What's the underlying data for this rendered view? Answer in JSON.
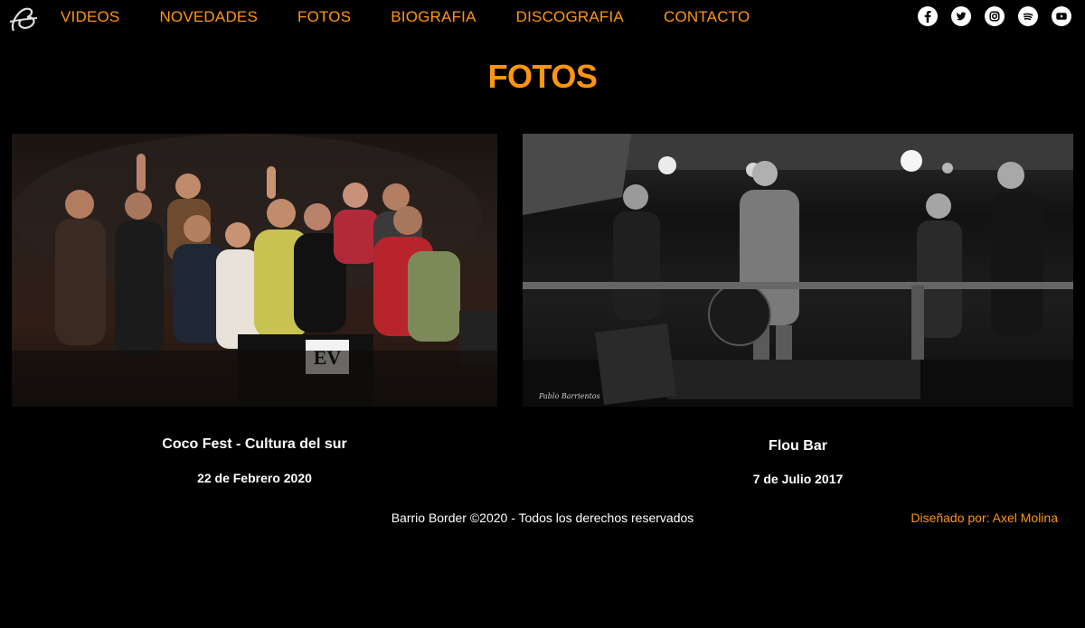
{
  "nav": {
    "items": [
      "VIDEOS",
      "NOVEDADES",
      "FOTOS",
      "BIOGRAFIA",
      "DISCOGRAFIA",
      "CONTACTO"
    ]
  },
  "social": [
    "facebook-icon",
    "twitter-icon",
    "instagram-icon",
    "spotify-icon",
    "youtube-icon"
  ],
  "page": {
    "title": "FOTOS"
  },
  "photos": [
    {
      "title": "Coco Fest - Cultura del sur",
      "date": "22 de Febrero 2020",
      "sign": "EV"
    },
    {
      "title": "Flou Bar",
      "date": "7 de Julio 2017",
      "watermark": "Pablo Barrientos"
    }
  ],
  "footer": {
    "copyright": "Barrio Border ©2020 - Todos los derechos reservados",
    "designed_by": "Diseñado por: Axel Molina"
  },
  "colors": {
    "accent": "#ff9512",
    "background": "#000000",
    "text": "#ffffff"
  }
}
